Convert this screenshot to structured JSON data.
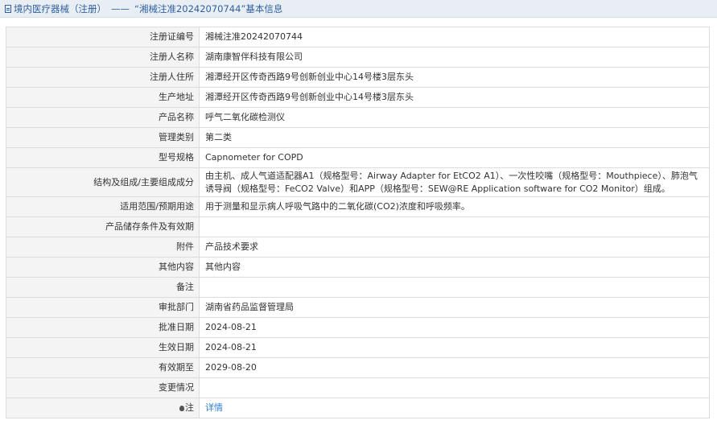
{
  "header": {
    "category": "境内医疗器械（注册）",
    "separator": "——",
    "title": "“湘械注准20242070744”基本信息"
  },
  "rows": [
    {
      "label": "注册证编号",
      "value": "湘械注准20242070744"
    },
    {
      "label": "注册人名称",
      "value": "湖南康智伴科技有限公司"
    },
    {
      "label": "注册人住所",
      "value": "湘潭经开区传奇西路9号创新创业中心14号楼3层东头"
    },
    {
      "label": "生产地址",
      "value": "湘潭经开区传奇西路9号创新创业中心14号楼3层东头"
    },
    {
      "label": "产品名称",
      "value": "呼气二氧化碳检测仪"
    },
    {
      "label": "管理类别",
      "value": "第二类"
    },
    {
      "label": "型号规格",
      "value": "Capnometer for COPD"
    },
    {
      "label": "结构及组成/主要组成成分",
      "value": "由主机、成人气道适配器A1（规格型号：Airway Adapter for EtCO2 A1）、一次性咬嘴（规格型号：Mouthpiece）、肺泡气诱导阀（规格型号：FeCO2 Valve）和APP（规格型号：SEW@RE Application software for CO2 Monitor）组成。"
    },
    {
      "label": "适用范围/预期用途",
      "value": "用于测量和显示病人呼吸气路中的二氧化碳(CO2)浓度和呼吸频率。"
    },
    {
      "label": "产品储存条件及有效期",
      "value": ""
    },
    {
      "label": "附件",
      "value": "产品技术要求"
    },
    {
      "label": "其他内容",
      "value": "其他内容"
    },
    {
      "label": "备注",
      "value": ""
    },
    {
      "label": "审批部门",
      "value": "湖南省药品监督管理局"
    },
    {
      "label": "批准日期",
      "value": "2024-08-21"
    },
    {
      "label": "生效日期",
      "value": "2024-08-21"
    },
    {
      "label": "有效期至",
      "value": "2029-08-20"
    },
    {
      "label": "变更情况",
      "value": ""
    }
  ],
  "note": {
    "label": "注",
    "link": "详情"
  }
}
